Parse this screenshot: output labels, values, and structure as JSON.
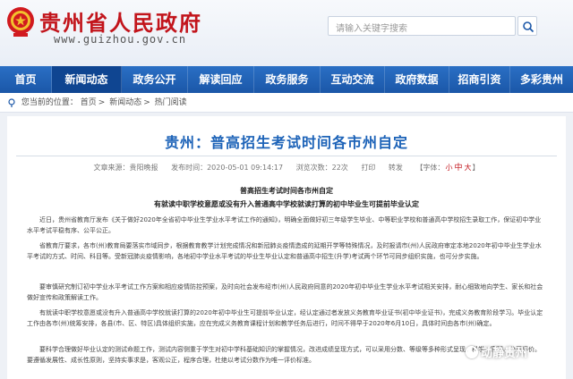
{
  "header": {
    "site_title": "贵州省人民政府",
    "site_domain": "www.guizhou.gov.cn",
    "search_placeholder": "请输入关键字搜索"
  },
  "colors": {
    "brand_red": "#c2141b",
    "nav_blue": "#1b57a8",
    "title_blue": "#1d63b8"
  },
  "nav": {
    "items": [
      "首页",
      "新闻动态",
      "政务公开",
      "解读回应",
      "政务服务",
      "互动交流",
      "政府数据",
      "招商引资",
      "多彩贵州"
    ],
    "active": "新闻动态"
  },
  "breadcrumb": {
    "prefix": "您当前的位置：",
    "items": [
      "首页",
      "新闻动态",
      "热门阅读"
    ]
  },
  "article": {
    "title": "贵州：普高招生考试时间各市州自定",
    "meta": {
      "source": "文章来源：贵阳晚报",
      "date": "发布时间：2020-05-01 09:14:17",
      "views": "浏览次数：22次",
      "print": "打印",
      "share": "转发",
      "font_label": "【字体：",
      "font_small": "小",
      "font_mid": "中",
      "font_large": "大",
      "font_end": "】"
    },
    "doc_title": "普高招生考试时间各市州自定",
    "doc_subtitle": "有就读中职学校意愿或没有升入普通高中学校就读打算的初中毕业生可提前毕业认定",
    "paragraphs": [
      "近日，贵州省教育厅发布《关于做好2020年全省初中毕业生学业水平考试工作的通知》，明确全面做好初三年级学生毕业、中等职业学校和普通高中学校招生录取工作，保证初中学业水平考试平稳有序、公平公正。",
      "省教育厅要求，各市(州)教育局要落实市域同步，根据教育教学计划完成情况和新冠肺炎疫情造成的延期开学等特殊情况，及时报请市(州)人民政府审定本地2020年初中毕业生学业水平考试的方式、时间、科目等。受新冠肺炎疫情影响，各地初中学业水平考试的毕业生毕业认定和普通高中招生(升学)考试两个环节可同步组织实施，也可分步实施。",
      "要审慎研究制订初中学业水平考试工作方案和相应疫情防控预案，及时向社会发布经市(州)人民政府同意的2020年初中毕业生学业水平考试相关安排，耐心细致地向学生、家长和社会做好宣传和政策解读工作。",
      "有就读中职学校意愿或没有升入普通高中学校就读打算的2020年初中毕业生可提前毕业认定，经认定通过者发放义务教育毕业证书(初中毕业证书)，完成义务教育阶段学习。毕业认定工作由各市(州)统筹安排，各县(市、区、特区)具体组织实施，应在完成义务教育课程计划和教学任务后进行，时间不得早于2020年6月10日，具体时间由各市(州)确定。",
      "要科学合理做好毕业认定的测试命题工作，测试内容侧重于学生对初中学科基础知识的掌握情况，改进成绩呈现方式，可以采用分数、等级等多种形式呈现，科学、客观、公正评价。要遵循发展性、成长性原则，坚持实事求是，客观公正，程序合理，杜绝以考试分数作为唯一评价标准。"
    ]
  },
  "watermark": "动静贵州"
}
